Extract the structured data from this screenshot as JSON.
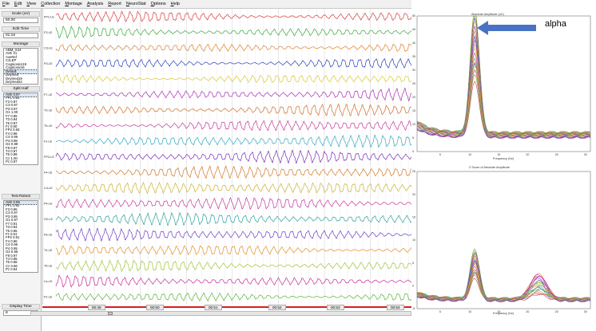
{
  "menu": [
    "File",
    "Edit",
    "View",
    "Collection",
    "Montage",
    "Analysis",
    "Report",
    "NeuroStat",
    "Options",
    "Help"
  ],
  "left_panel": {
    "scale_label": "Scale (uV)",
    "scale_value": "50.00",
    "edit_time_label": "Edit Time",
    "edit_time_value": "01:16",
    "montage_label": "Montage",
    "montage_items": [
      "ABM_X24",
      "AVE 21",
      "AveRef",
      "CzLEP",
      "Cognionics19",
      "Cognionics6",
      "Default",
      "Deymed",
      "Deymed19",
      "Deymed22"
    ],
    "split_half_label": "Split Half",
    "split_half_items": [
      "AVE 0.97",
      "FP1 0.93",
      "F3 0.97",
      "C3 0.97",
      "P3 0.97",
      "O1 1.00",
      "F7 0.96",
      "T3 0.94",
      "T5 0.97",
      "Fz 0.90",
      "FP2 0.93",
      "F4 0.98",
      "C4 0.99",
      "P4 0.98",
      "O2 0.99",
      "F8 0.97",
      "T4 0.97",
      "T6 0.99",
      "Cz 1.00",
      "Pz 0.97"
    ],
    "test_retest_label": "Test Retest",
    "test_retest_items": [
      "AVE 0.95",
      "FP1 0.92",
      "F3 0.96",
      "C3 0.97",
      "P3 0.95",
      "O1 0.97",
      "F7 0.91",
      "T3 0.94",
      "T5 0.95",
      "Fz 0.91",
      "FP2 0.91",
      "F4 0.96",
      "C4 0.96",
      "P4 0.95",
      "O2 0.95",
      "F8 0.97",
      "T4 0.95",
      "T6 0.98",
      "Cz 0.96",
      "Pz 0.94"
    ],
    "display_time_label": "Display Time",
    "display_time_value": "8"
  },
  "channels": [
    "FP1-LE",
    "F3-LE",
    "C3-LE",
    "P3-LE",
    "O1-LE",
    "F7-LE",
    "T3-LE",
    "T5-LE",
    "Fz-LE",
    "FP2-LE",
    "F4-LE",
    "C4-LE",
    "P4-LE",
    "O2-LE",
    "F8-LE",
    "T4-LE",
    "T6-LE",
    "Cz-LE",
    "Pz-LE"
  ],
  "channel_colors": [
    "#d43d3d",
    "#3aa83a",
    "#d9822b",
    "#2c3fb8",
    "#d8c832",
    "#a52fb0",
    "#cf6f2a",
    "#c23a9a",
    "#30a7c4",
    "#7a2fb5",
    "#cf7a2a",
    "#c9b233",
    "#c23aa0",
    "#2f9f9f",
    "#6f3fc0",
    "#e0902a",
    "#9fc43a",
    "#c2309a",
    "#5ab43a"
  ],
  "time_labels": [
    "00:49",
    "00:50",
    "00:51",
    "00:52",
    "00:53",
    "00:54"
  ],
  "plots": {
    "top_title": "Absolute Amplitude (uV)",
    "bottom_title": "Z Score of Absolute Amplitude",
    "xlabel": "Frequency (Hz)",
    "x_ticks": [
      "5",
      "10",
      "15",
      "20",
      "25",
      "30"
    ],
    "top_y_ticks": [
      "0",
      "5",
      "10",
      "15",
      "20",
      "25",
      "30",
      "35",
      "40",
      "45",
      "50"
    ],
    "bottom_y_ticks": [
      "-5",
      "0",
      "5",
      "10",
      "15",
      "20",
      "25"
    ]
  },
  "annotation": {
    "label": "alpha",
    "arrow_color": "#4a72c4"
  }
}
